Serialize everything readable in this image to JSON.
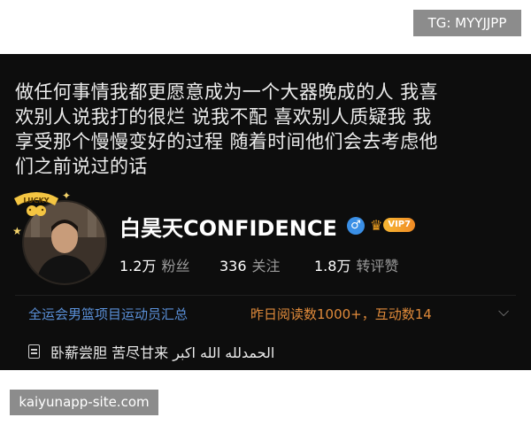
{
  "watermark_top": "TG: MYYJJPP",
  "watermark_bottom": "kaiyunapp-site.com",
  "quote": {
    "lines": [
      "做任何事情我都更愿意成为一个大器晚成的人 我喜",
      "欢别人说我打的很烂 说我不配 喜欢别人质疑我 我",
      "享受那个慢慢变好的过程 随着时间他们会去考虑他",
      "们之前说过的话"
    ]
  },
  "profile": {
    "avatar_tag": "LUCKY",
    "username": "白昊天CONFIDENCE",
    "gender_icon": "male-icon",
    "vip_label": "VIP7",
    "stats": [
      {
        "value": "1.2万",
        "label": "粉丝"
      },
      {
        "value": "336",
        "label": "关注"
      },
      {
        "value": "1.8万",
        "label": "转评赞"
      }
    ]
  },
  "promo": {
    "left": "全运会男篮项目运动员汇总",
    "right": "昨日阅读数1000+，互动数14"
  },
  "bio": "卧薪尝胆 苦尽甘来 الحمدلله  الله اكبر",
  "colors": {
    "panel_bg": "#0d0d0d",
    "link_blue": "#5a90d8",
    "promo_orange": "#e08a3a",
    "vip_gold": "#f7b733"
  }
}
